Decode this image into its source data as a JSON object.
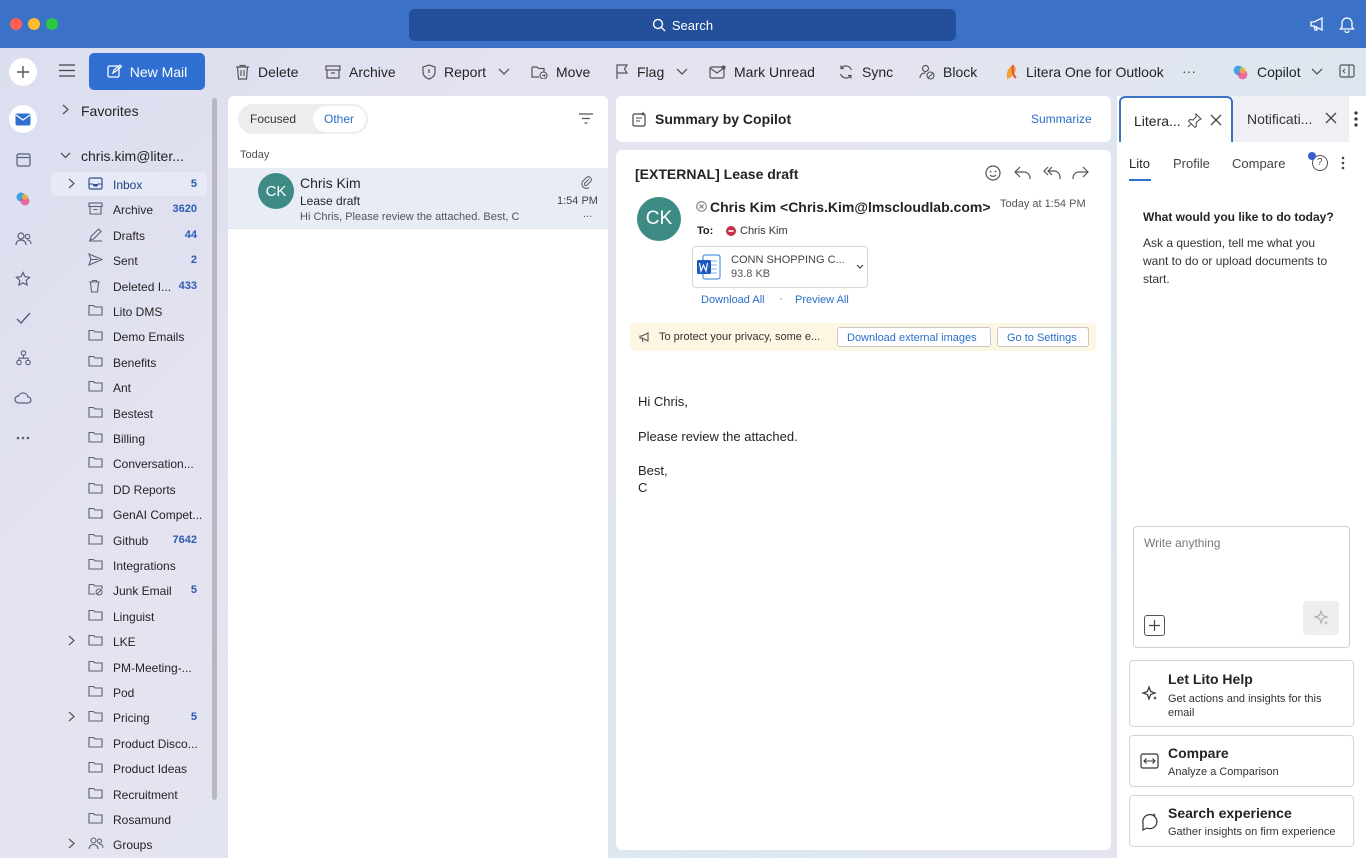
{
  "titlebar": {
    "search_label": "Search"
  },
  "ribbon": {
    "new_mail": "New Mail",
    "delete": "Delete",
    "archive": "Archive",
    "report": "Report",
    "move": "Move",
    "flag": "Flag",
    "mark_unread": "Mark Unread",
    "sync": "Sync",
    "block": "Block",
    "litera": "Litera One for Outlook",
    "more": "···",
    "copilot": "Copilot"
  },
  "folders": {
    "favorites": "Favorites",
    "account": "chris.kim@liter...",
    "items": [
      {
        "name": "Inbox",
        "count": "5"
      },
      {
        "name": "Archive",
        "count": "3620"
      },
      {
        "name": "Drafts",
        "count": "44"
      },
      {
        "name": "Sent",
        "count": "2"
      },
      {
        "name": "Deleted I...",
        "count": "433"
      },
      {
        "name": "Lito DMS",
        "count": ""
      },
      {
        "name": "Demo Emails",
        "count": ""
      },
      {
        "name": "Benefits",
        "count": ""
      },
      {
        "name": "Ant",
        "count": ""
      },
      {
        "name": "Bestest",
        "count": ""
      },
      {
        "name": "Billing",
        "count": ""
      },
      {
        "name": "Conversation...",
        "count": ""
      },
      {
        "name": "DD Reports",
        "count": ""
      },
      {
        "name": "GenAI Compet...",
        "count": ""
      },
      {
        "name": "Github",
        "count": "7642"
      },
      {
        "name": "Integrations",
        "count": ""
      },
      {
        "name": "Junk Email",
        "count": "5"
      },
      {
        "name": "Linguist",
        "count": ""
      },
      {
        "name": "LKE",
        "count": ""
      },
      {
        "name": "PM-Meeting-...",
        "count": ""
      },
      {
        "name": "Pod",
        "count": ""
      },
      {
        "name": "Pricing",
        "count": "5"
      },
      {
        "name": "Product Disco...",
        "count": ""
      },
      {
        "name": "Product Ideas",
        "count": ""
      },
      {
        "name": "Recruitment",
        "count": ""
      },
      {
        "name": "Rosamund",
        "count": ""
      },
      {
        "name": "Groups",
        "count": ""
      }
    ]
  },
  "list": {
    "tab_focused": "Focused",
    "tab_other": "Other",
    "group_today": "Today",
    "message": {
      "initials": "CK",
      "sender": "Chris Kim",
      "subject": "Lease draft",
      "time": "1:54 PM",
      "preview": "Hi Chris, Please review the attached. Best, C",
      "ellipsis": "..."
    }
  },
  "summary": {
    "title": "Summary by Copilot",
    "action": "Summarize"
  },
  "email": {
    "subject": "[EXTERNAL] Lease draft",
    "initials": "CK",
    "from": "Chris Kim <Chris.Kim@lmscloudlab.com>",
    "date": "Today at 1:54 PM",
    "to_label": "To:",
    "to_name": "Chris Kim",
    "attachment_name": "CONN SHOPPING C...",
    "attachment_size": "93.8 KB",
    "download_all": "Download All",
    "separator": "·",
    "preview_all": "Preview All",
    "privacy_text": "To protect your privacy, some e...",
    "download_images": "Download external images",
    "go_settings": "Go to Settings",
    "body_greeting": "Hi Chris,",
    "body_line": "Please review the attached.",
    "body_signoff": "Best,",
    "body_name": "C"
  },
  "rpanel": {
    "tab_litera": "Litera...",
    "tab_notifications": "Notificati...",
    "subtabs": [
      "Lito",
      "Profile",
      "Compare"
    ],
    "help_badge": "?",
    "prompt_title": "What would you like to do today?",
    "prompt_body": "Ask a question, tell me what you want to do or upload documents to start.",
    "input_placeholder": "Write anything",
    "cards": [
      {
        "title": "Let Lito Help",
        "desc": "Get actions and insights for this email"
      },
      {
        "title": "Compare",
        "desc": "Analyze a Comparison"
      },
      {
        "title": "Search experience",
        "desc": "Gather insights on firm experience"
      }
    ]
  }
}
